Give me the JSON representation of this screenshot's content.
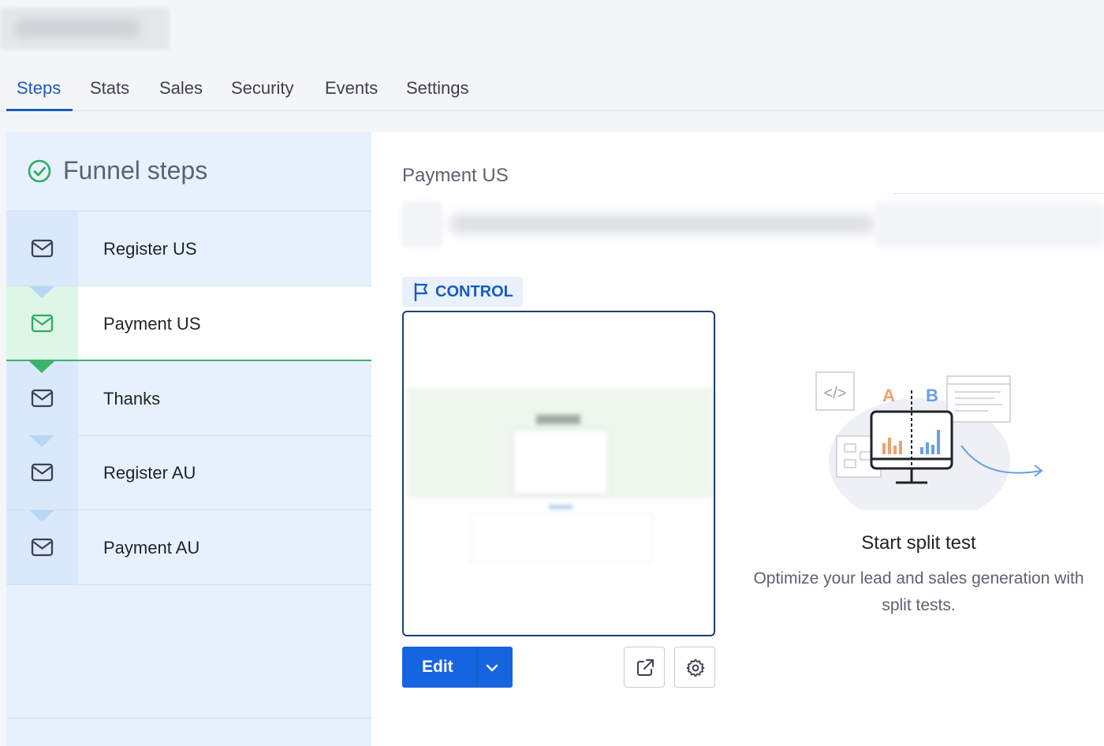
{
  "tabs": [
    {
      "label": "Steps",
      "active": true
    },
    {
      "label": "Stats"
    },
    {
      "label": "Sales"
    },
    {
      "label": "Security"
    },
    {
      "label": "Events"
    },
    {
      "label": "Settings"
    }
  ],
  "sidebar": {
    "title": "Funnel steps",
    "title_icon": "check-circle-icon",
    "steps": [
      {
        "label": "Register US",
        "icon": "envelope-icon"
      },
      {
        "label": "Payment US",
        "icon": "envelope-icon",
        "active": true
      },
      {
        "label": "Thanks",
        "icon": "envelope-icon"
      },
      {
        "label": "Register AU",
        "icon": "envelope-icon"
      },
      {
        "label": "Payment AU",
        "icon": "envelope-icon"
      }
    ]
  },
  "main": {
    "title": "Payment US",
    "variant_badge": "CONTROL",
    "edit_button": "Edit",
    "split_test": {
      "title": "Start split test",
      "description": "Optimize your lead and sales generation with split tests.",
      "label_a": "A",
      "label_b": "B"
    }
  },
  "colors": {
    "accent": "#1a5bbf",
    "button": "#1565e0",
    "success": "#3cb26a",
    "sidebar_bg": "#e6f1fd"
  }
}
